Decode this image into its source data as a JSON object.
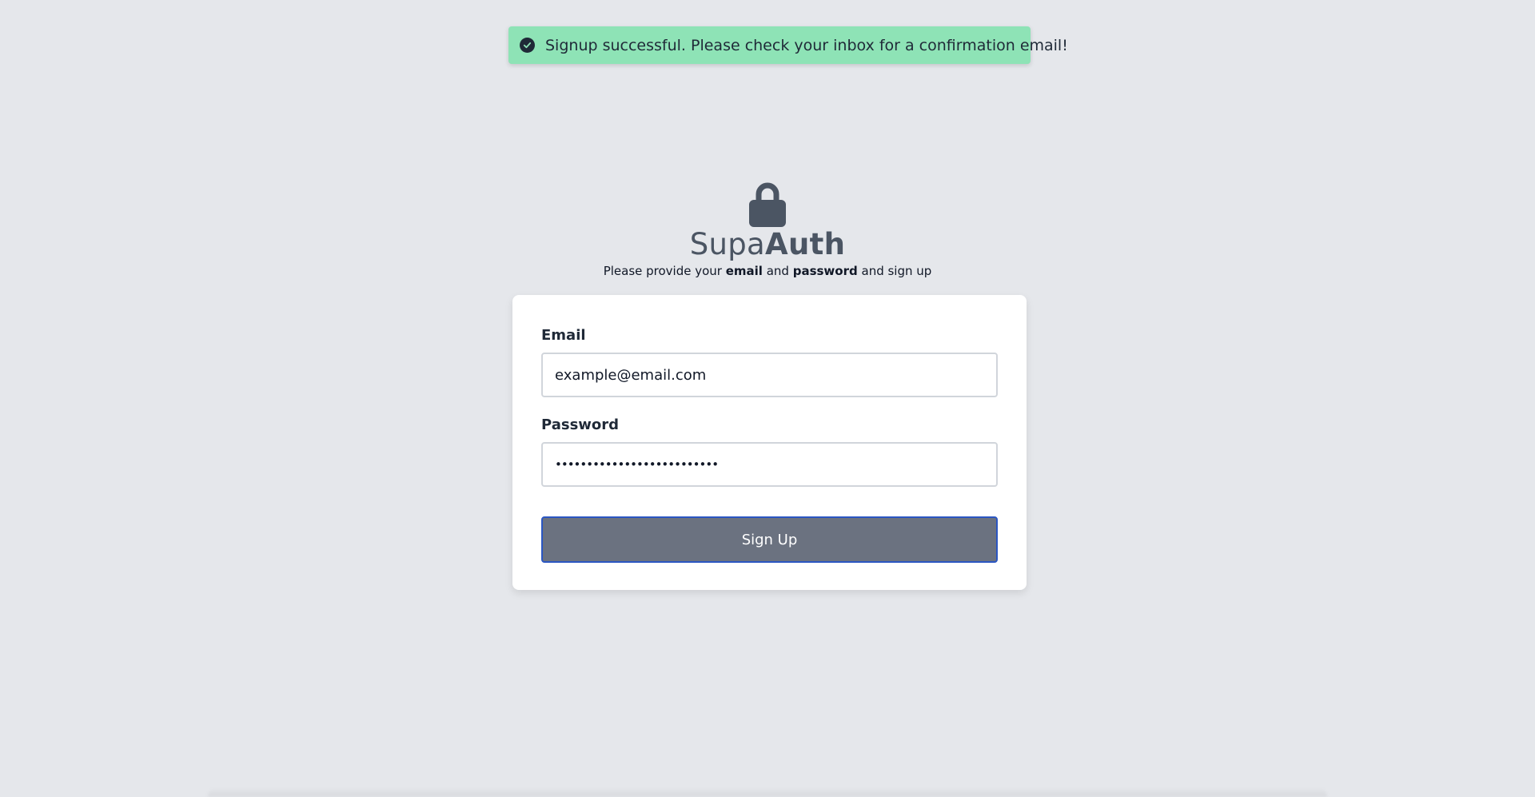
{
  "toast": {
    "icon": "check-circle-icon",
    "message": "Signup successful. Please check your inbox for a confirmation email!",
    "color": "#8ee3b6"
  },
  "brand": {
    "icon": "lock-icon",
    "name_regular": "Supa",
    "name_bold": "Auth"
  },
  "subtitle": {
    "prefix": "Please provide your ",
    "email_word": "email",
    "and1": " and ",
    "password_word": "password",
    "suffix": " and sign up"
  },
  "form": {
    "email_label": "Email",
    "email_value": "example@email.com",
    "password_label": "Password",
    "password_value": "••••••••••••••••••••••••••",
    "submit_label": "Sign Up",
    "submit_color": "#6b7280",
    "focus_border_color": "#2b56c2"
  }
}
